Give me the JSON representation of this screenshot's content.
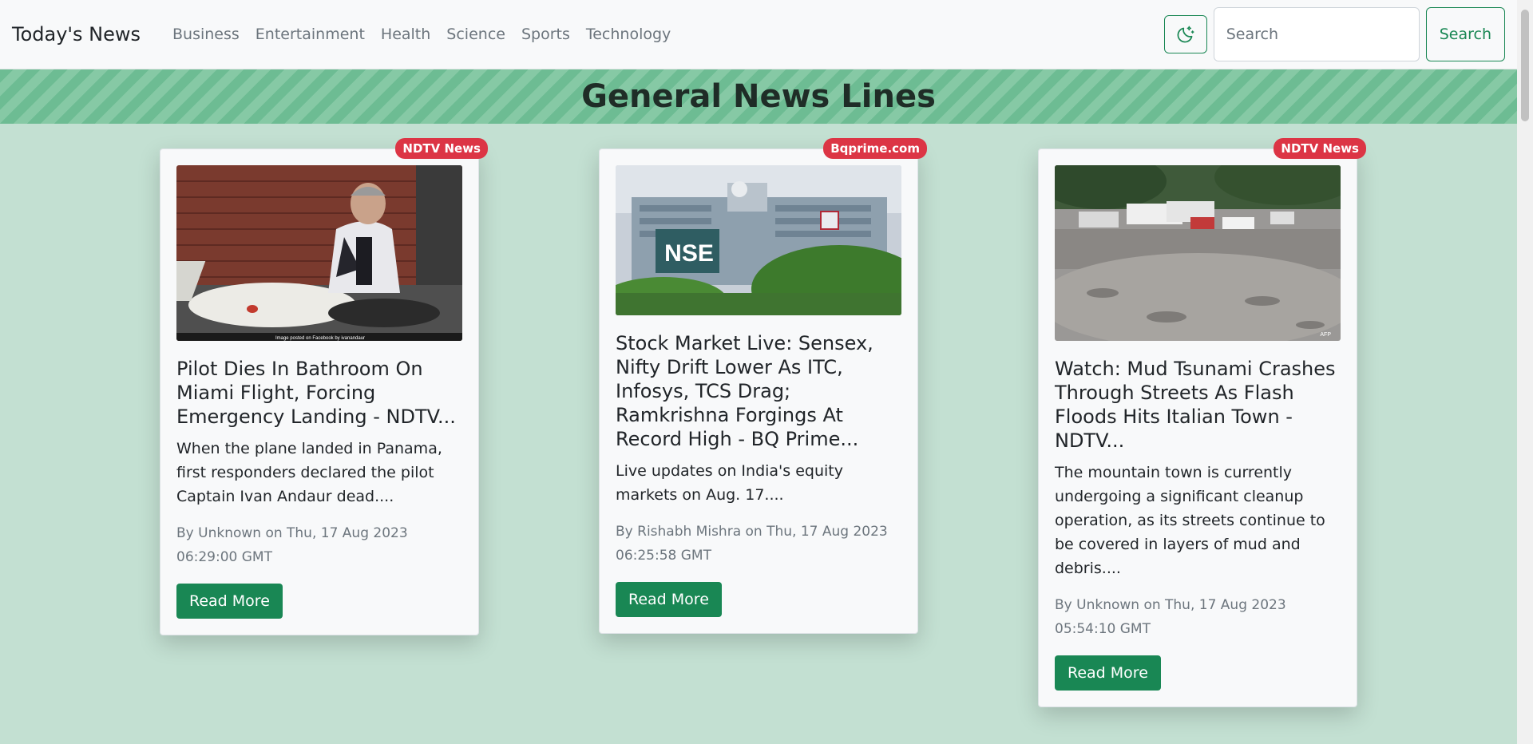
{
  "navbar": {
    "brand": "Today's News",
    "links": [
      "Business",
      "Entertainment",
      "Health",
      "Science",
      "Sports",
      "Technology"
    ],
    "search_placeholder": "Search",
    "search_button": "Search"
  },
  "banner": {
    "title": "General News Lines"
  },
  "cards": [
    {
      "source": "NDTV News",
      "title": "Pilot Dies In Bathroom On Miami Flight, Forcing Emergency Landing - NDTV...",
      "description": "When the plane landed in Panama, first responders declared the pilot Captain Ivan Andaur dead....",
      "meta": "By Unknown on Thu, 17 Aug 2023 06:29:00 GMT",
      "button": "Read More",
      "image_caption": "Image posted on Facebook by ivanandaur"
    },
    {
      "source": "Bqprime.com",
      "title": "Stock Market Live: Sensex, Nifty Drift Lower As ITC, Infosys, TCS Drag; Ramkrishna Forgings At Record High - BQ Prime...",
      "description": "Live updates on India's equity markets on Aug. 17....",
      "meta": "By Rishabh Mishra on Thu, 17 Aug 2023 06:25:58 GMT",
      "button": "Read More",
      "image_sign": "NSE"
    },
    {
      "source": "NDTV News",
      "title": "Watch: Mud Tsunami Crashes Through Streets As Flash Floods Hits Italian Town - NDTV...",
      "description": "The mountain town is currently undergoing a significant cleanup operation, as its streets continue to be covered in layers of mud and debris....",
      "meta": "By Unknown on Thu, 17 Aug 2023 05:54:10 GMT",
      "button": "Read More",
      "image_credit": "AFP"
    }
  ],
  "colors": {
    "accent": "#198754",
    "badge": "#dc3545",
    "background": "#c3e0d2"
  },
  "icons": {
    "mode_toggle": "moon-stars-icon"
  }
}
